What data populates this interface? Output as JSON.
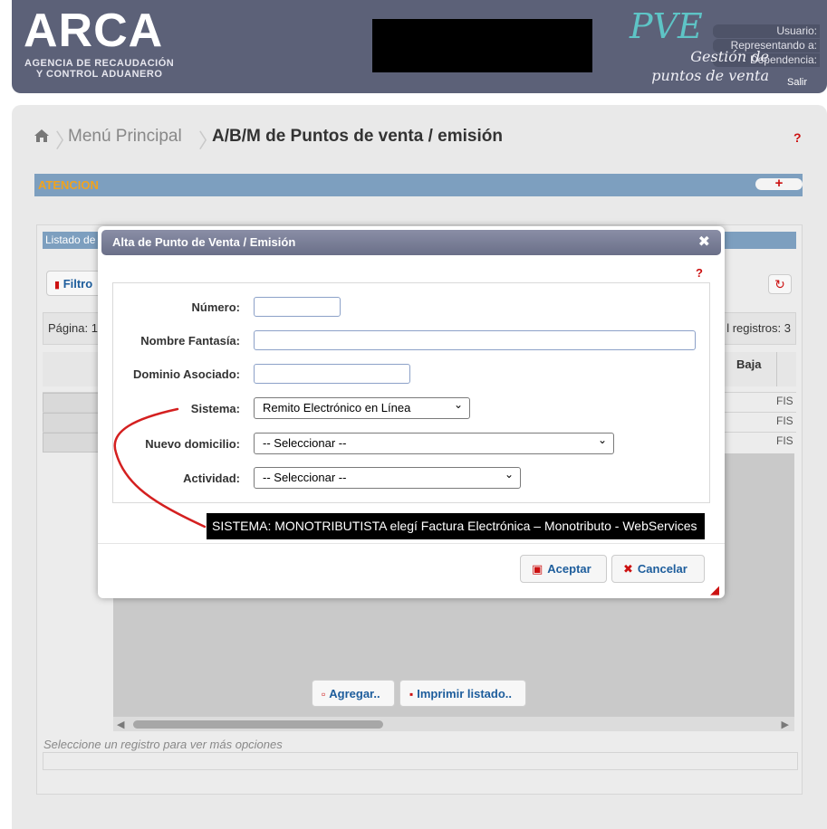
{
  "header": {
    "logo": "ARCA",
    "logo_sub_1": "AGENCIA DE RECAUDACIÓN",
    "logo_sub_2": "Y CONTROL ADUANERO",
    "user_labels": [
      "Usuario:",
      "Representando a:",
      "Dependencia:"
    ],
    "app_logo": "PVE",
    "app_subtitle_1": "Gestión de",
    "app_subtitle_2": "puntos de venta",
    "logout": "Salir"
  },
  "breadcrumb": {
    "home": "home-icon",
    "items": [
      "Menú Principal",
      "A/B/M de Puntos de venta / emisión"
    ],
    "help": "?"
  },
  "atencion": {
    "title": "ATENCION",
    "toggle": "+"
  },
  "grid": {
    "title": "Listado de",
    "filter_label": "Filtro",
    "paging_left": "Página: 1",
    "paging_right": "l registros: 3",
    "col_baja": "Baja",
    "rows": [
      "FIS",
      "FIS",
      "FIS"
    ],
    "select_hint": "Seleccione un registro para ver más opciones"
  },
  "actions": {
    "add": "Agregar..",
    "print": "Imprimir listado.."
  },
  "modal": {
    "title": "Alta de Punto de Venta / Emisión",
    "help": "?",
    "fields": {
      "numero_label": "Número:",
      "numero_value": "",
      "fantasia_label": "Nombre Fantasía:",
      "fantasia_value": "",
      "dominio_label": "Dominio Asociado:",
      "dominio_value": "",
      "sistema_label": "Sistema:",
      "sistema_value": "Remito Electrónico en Línea",
      "domicilio_label": "Nuevo domicilio:",
      "domicilio_value": "-- Seleccionar --",
      "actividad_label": "Actividad:",
      "actividad_value": "-- Seleccionar --"
    },
    "accept": "Aceptar",
    "cancel": "Cancelar"
  },
  "annotation": {
    "text": "SISTEMA: MONOTRIBUTISTA elegí Factura Electrónica – Monotributo - WebServices",
    "arrow_color": "#d42020"
  },
  "colors": {
    "header_bg": "#5c6178",
    "panel_title": "#7d9fbf",
    "attention": "#f0a31e",
    "accent_red": "#cc1111",
    "link_blue": "#1d5d9c",
    "pve_teal": "#5ec4c6"
  }
}
